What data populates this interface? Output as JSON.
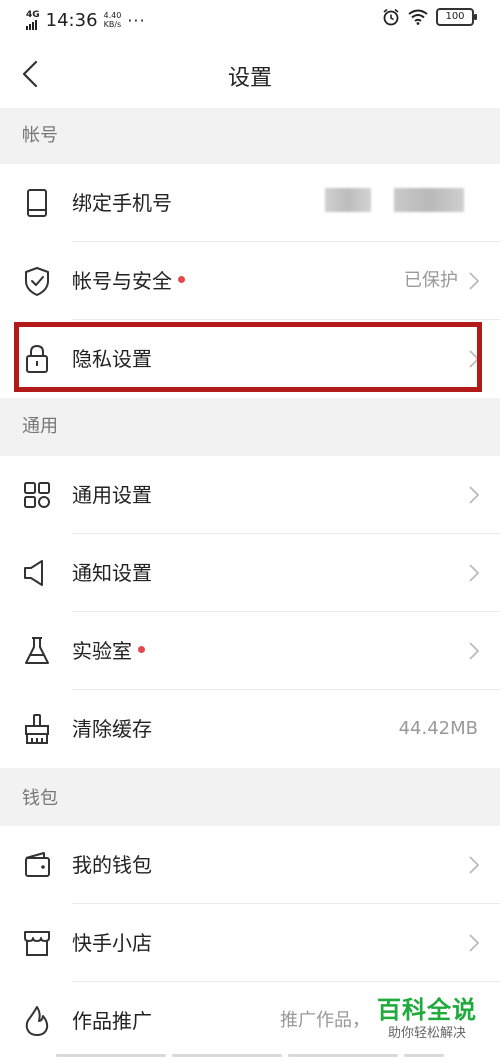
{
  "status_bar": {
    "network": "4G",
    "time": "14:36",
    "speed_value": "4.40",
    "speed_unit": "KB/s",
    "dots": "···",
    "battery": "100"
  },
  "header": {
    "title": "设置"
  },
  "sections": {
    "account": {
      "title": "帐号",
      "bind_phone": {
        "label": "绑定手机号"
      },
      "account_security": {
        "label": "帐号与安全",
        "value": "已保护",
        "has_dot": true
      },
      "privacy": {
        "label": "隐私设置"
      }
    },
    "general": {
      "title": "通用",
      "general_settings": {
        "label": "通用设置"
      },
      "notification_settings": {
        "label": "通知设置"
      },
      "lab": {
        "label": "实验室",
        "has_dot": true
      },
      "clear_cache": {
        "label": "清除缓存",
        "value": "44.42MB"
      }
    },
    "wallet": {
      "title": "钱包",
      "my_wallet": {
        "label": "我的钱包"
      },
      "kuaishou_store": {
        "label": "快手小店"
      },
      "promotion": {
        "label": "作品推广",
        "value": "推广作品，"
      }
    }
  },
  "watermark": {
    "title": "百科全说",
    "subtitle": "助你轻松解决"
  },
  "colors": {
    "accent_dot": "#e5484d",
    "highlight": "#b31b1b",
    "section_bg": "#f2f2f2",
    "watermark_green": "#1faa3c"
  }
}
